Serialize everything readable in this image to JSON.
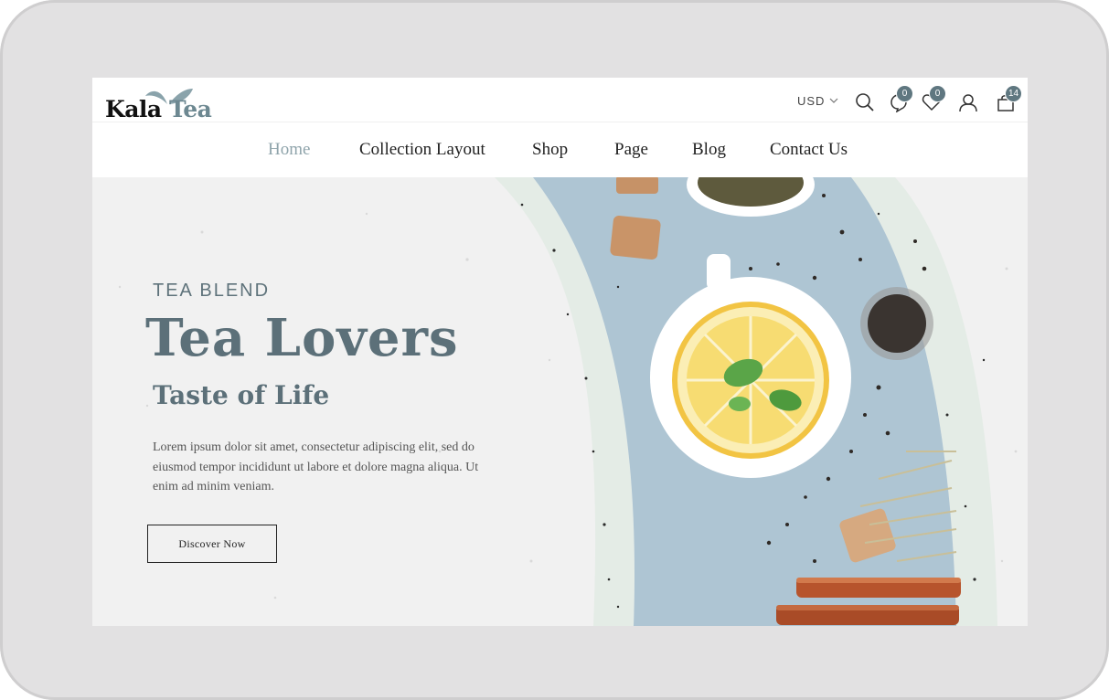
{
  "header": {
    "logo": {
      "part1": "Kala",
      "part2": "Tea"
    },
    "currency": "USD",
    "compare_count": "0",
    "wishlist_count": "0",
    "cart_count": "14"
  },
  "nav": {
    "items": [
      {
        "label": "Home",
        "active": true
      },
      {
        "label": "Collection Layout"
      },
      {
        "label": "Shop"
      },
      {
        "label": "Page"
      },
      {
        "label": "Blog"
      },
      {
        "label": "Contact Us"
      }
    ]
  },
  "hero": {
    "eyebrow": "TEA BLEND",
    "title": "Tea Lovers",
    "subtitle": "Taste of Life",
    "description": "Lorem ipsum dolor sit amet, consectetur adipiscing elit, sed do eiusmod tempor incididunt ut labore et dolore magna aliqua. Ut enim ad minim veniam.",
    "cta_label": "Discover Now"
  },
  "colors": {
    "accent": "#5f7780",
    "nav_active": "#8fa4ab",
    "hero_bg": "#f1f1f1",
    "table_blue": "#aec5d3"
  },
  "icons": [
    "leaf-icon",
    "chevron-down-icon",
    "search-icon",
    "compare-icon",
    "heart-icon",
    "user-icon",
    "bag-icon"
  ]
}
